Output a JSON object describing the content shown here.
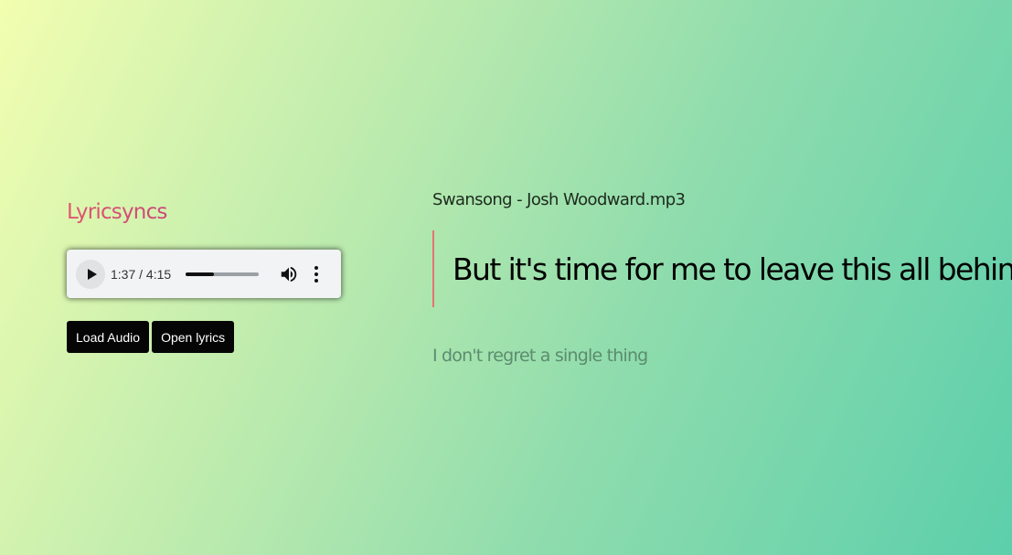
{
  "app": {
    "title": "Lyricsyncs",
    "title_color": "#e0566f"
  },
  "player": {
    "time_display": "1:37 / 4:15",
    "progress_fraction": 0.38,
    "play_icon": "play-icon",
    "volume_icon": "volume-icon",
    "menu_icon": "more-vertical-icon"
  },
  "buttons": {
    "load_audio": "Load Audio",
    "open_lyrics": "Open lyrics"
  },
  "track": {
    "filename": "Swansong - Josh Woodward.mp3"
  },
  "lyrics": {
    "current": "But it's time for me to leave this all behind",
    "next": "I don't regret a single thing",
    "accent_color": "#e57373"
  }
}
